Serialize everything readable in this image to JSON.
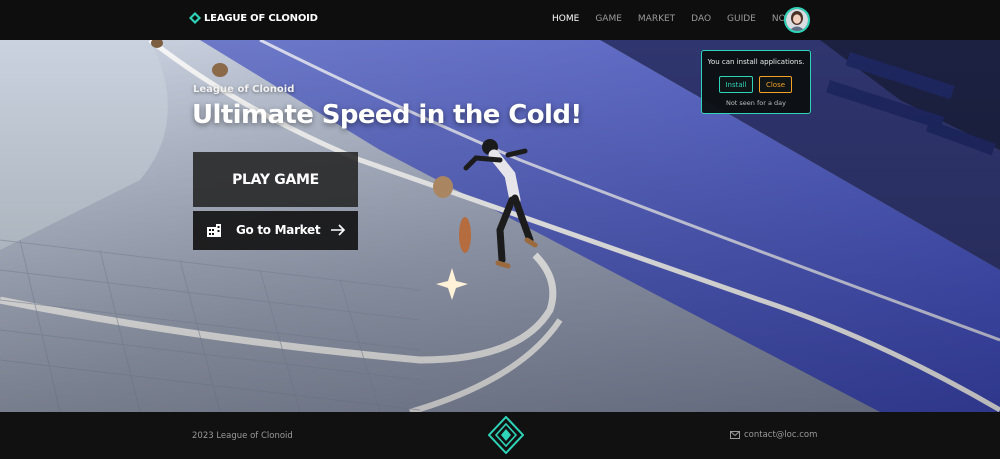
{
  "brand": {
    "name": "LEAGUE OF CLONOID",
    "accent": "#2fd3b8"
  },
  "nav": {
    "items": [
      {
        "label": "HOME",
        "active": true
      },
      {
        "label": "GAME",
        "active": false
      },
      {
        "label": "MARKET",
        "active": false
      },
      {
        "label": "DAO",
        "active": false
      },
      {
        "label": "GUIDE",
        "active": false
      },
      {
        "label": "NOTICE",
        "active": false
      }
    ],
    "avatar_icon": "user-avatar"
  },
  "hero": {
    "eyebrow": "League of Clonoid",
    "title": "Ultimate Speed in the Cold!",
    "play_button": "PLAY GAME",
    "market_button": "Go to Market",
    "market_icon": "building-icon",
    "market_arrow_icon": "arrow-right-icon"
  },
  "install_popup": {
    "message": "You can install applications.",
    "install_label": "Install",
    "close_label": "Close",
    "dismiss_label": "Not seen for a day",
    "install_color": "#2fd3b8",
    "close_color": "#f0a126"
  },
  "footer": {
    "copyright": "2023 League of Clonoid",
    "contact": "contact@loc.com",
    "contact_icon": "mail-icon",
    "logo_icon": "clonoid-diamond-logo"
  }
}
